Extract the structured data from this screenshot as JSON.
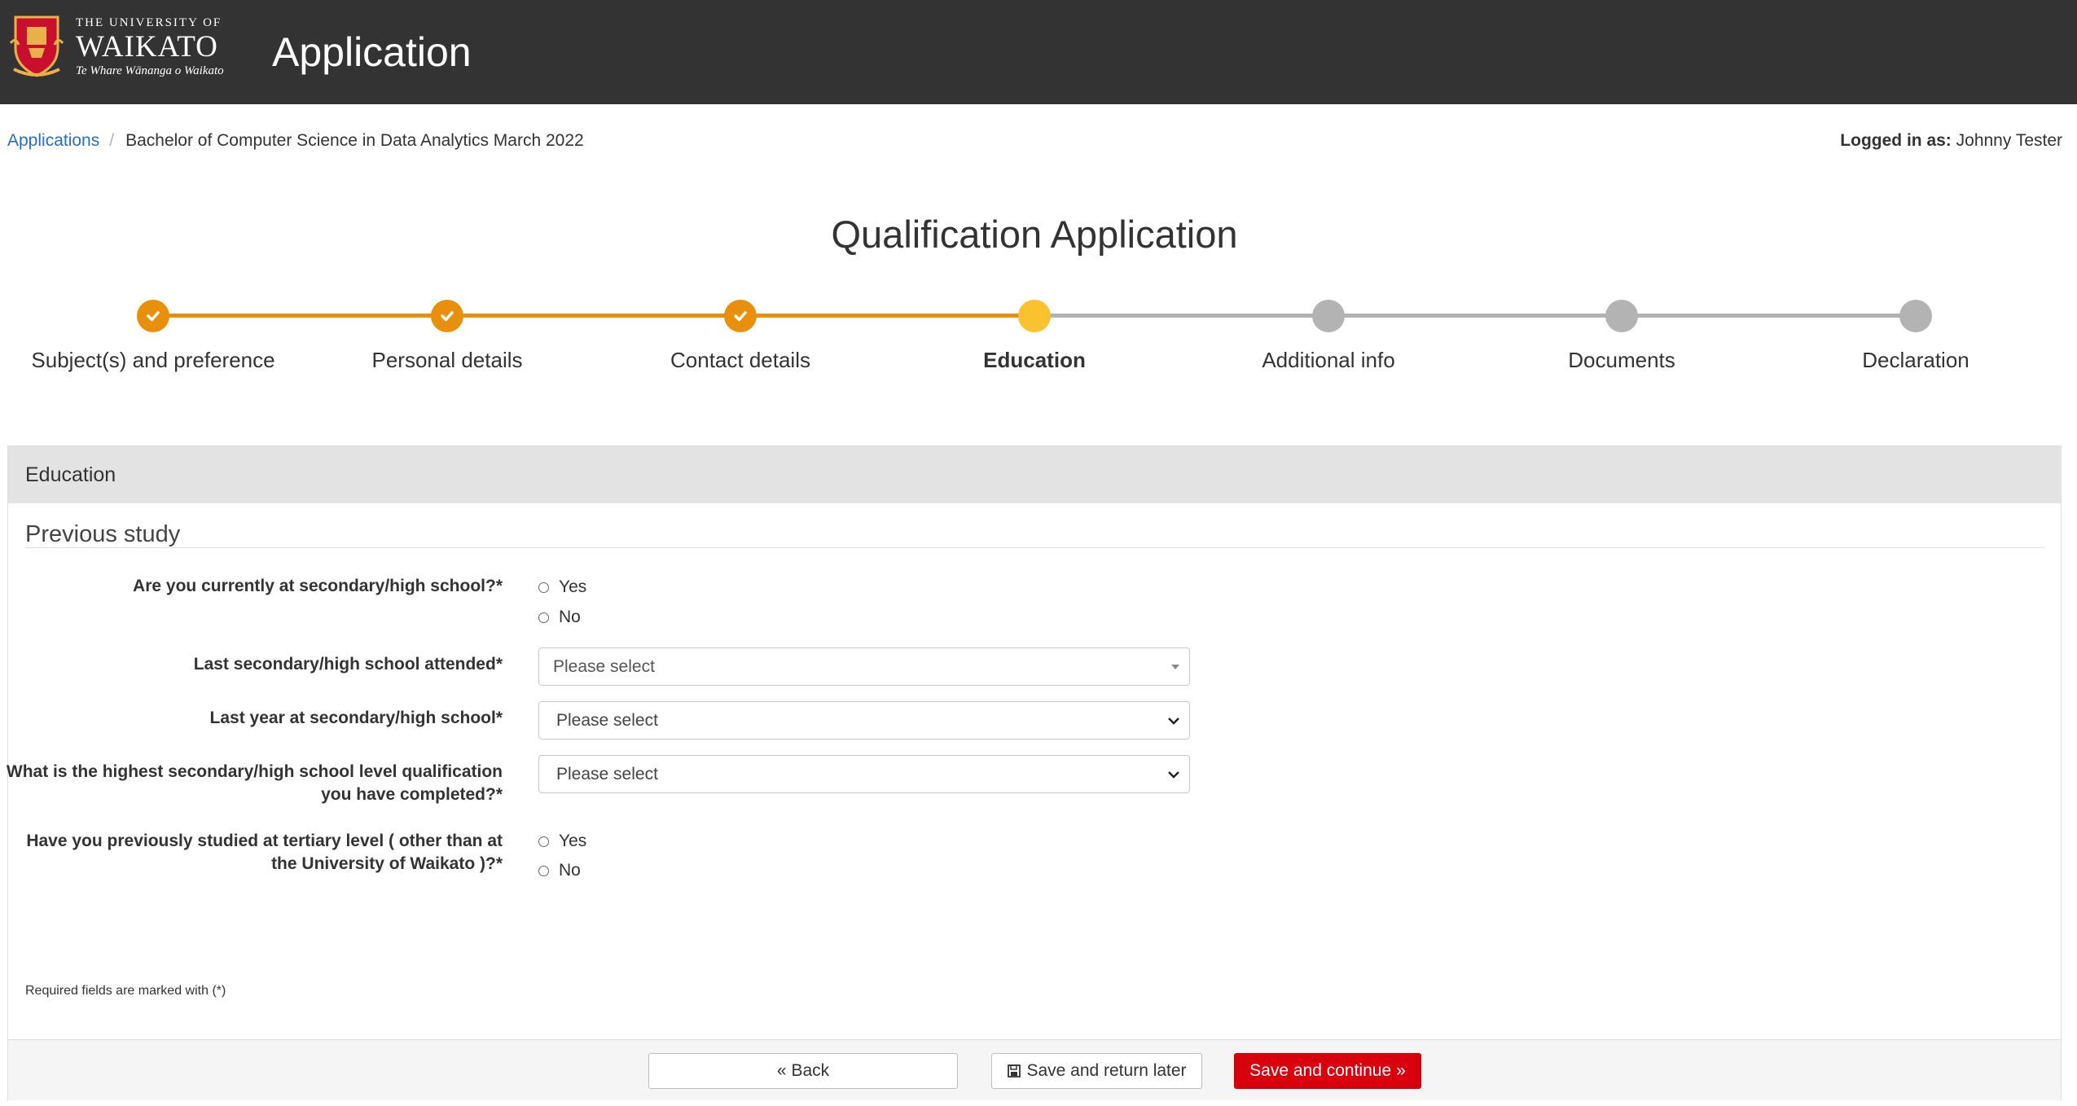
{
  "header": {
    "uni_small": "THE UNIVERSITY OF",
    "uni_name": "WAIKATO",
    "uni_maori": "Te Whare Wānanga o Waikato",
    "app_title": "Application"
  },
  "breadcrumb": {
    "root": "Applications",
    "current": "Bachelor of Computer Science in Data Analytics March 2022"
  },
  "user": {
    "logged_label": "Logged in as:",
    "name": "Johnny Tester"
  },
  "page_title": "Qualification Application",
  "stepper": {
    "steps": [
      {
        "label": "Subject(s) and preference",
        "status": "done"
      },
      {
        "label": "Personal details",
        "status": "done"
      },
      {
        "label": "Contact details",
        "status": "done"
      },
      {
        "label": "Education",
        "status": "current"
      },
      {
        "label": "Additional info",
        "status": "todo"
      },
      {
        "label": "Documents",
        "status": "todo"
      },
      {
        "label": "Declaration",
        "status": "todo"
      }
    ],
    "colors": {
      "done": "#e8900c",
      "current": "#f9c22e",
      "todo": "#b3b3b3"
    }
  },
  "panel": {
    "heading": "Education",
    "section": "Previous study",
    "questions": {
      "q1": {
        "label": "Are you currently at secondary/high school?*",
        "options": [
          "Yes",
          "No"
        ]
      },
      "q2": {
        "label": "Last secondary/high school attended*",
        "placeholder": "Please select"
      },
      "q3": {
        "label": "Last year at secondary/high school*",
        "placeholder": "Please select"
      },
      "q4": {
        "label_line1": "What is the highest secondary/high school level qualification",
        "label_line2": "you have completed?*",
        "placeholder": "Please select"
      },
      "q5": {
        "label_line1": "Have you previously studied at tertiary level ( other than at",
        "label_line2": "the University of Waikato )?*",
        "options": [
          "Yes",
          "No"
        ]
      }
    },
    "required_note": "Required fields are marked with (*)"
  },
  "buttons": {
    "back": "Back",
    "save_later": "Save and return later",
    "continue": "Save and continue",
    "continue_color": "#d8000c"
  }
}
